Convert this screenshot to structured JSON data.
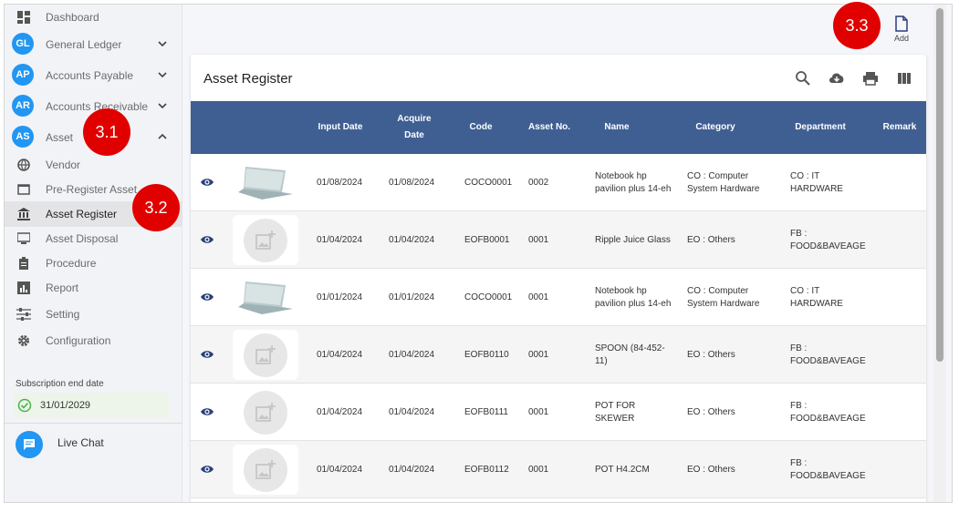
{
  "sidebar": {
    "items": [
      {
        "label": "Dashboard",
        "badge": "",
        "icon": "dashboard-icon",
        "chevron": ""
      },
      {
        "label": "General Ledger",
        "badge": "GL",
        "icon": "",
        "chevron": "down"
      },
      {
        "label": "Accounts Payable",
        "badge": "AP",
        "icon": "",
        "chevron": "down"
      },
      {
        "label": "Accounts Receivable",
        "badge": "AR",
        "icon": "",
        "chevron": "down"
      },
      {
        "label": "Asset",
        "badge": "AS",
        "icon": "",
        "chevron": "up"
      },
      {
        "label": "Vendor",
        "badge": "",
        "icon": "globe-icon",
        "chevron": ""
      },
      {
        "label": "Pre-Register Asset",
        "badge": "",
        "icon": "window-icon",
        "chevron": ""
      },
      {
        "label": "Asset Register",
        "badge": "",
        "icon": "bank-icon",
        "chevron": "",
        "active": true
      },
      {
        "label": "Asset Disposal",
        "badge": "",
        "icon": "monitor-icon",
        "chevron": ""
      },
      {
        "label": "Procedure",
        "badge": "",
        "icon": "clipboard-icon",
        "chevron": ""
      },
      {
        "label": "Report",
        "badge": "",
        "icon": "report-icon",
        "chevron": ""
      },
      {
        "label": "Setting",
        "badge": "",
        "icon": "sliders-icon",
        "chevron": ""
      },
      {
        "label": "Configuration",
        "badge": "",
        "icon": "gear-icon",
        "chevron": ""
      }
    ],
    "subscription_label": "Subscription end date",
    "subscription_date": "31/01/2029",
    "live_chat": "Live Chat"
  },
  "callouts": {
    "c1": "3.1",
    "c2": "3.2",
    "c3": "3.3"
  },
  "header": {
    "add_label": "Add"
  },
  "card": {
    "title": "Asset Register",
    "toolbar_icons": [
      "search-icon",
      "cloud-download-icon",
      "print-icon",
      "columns-icon"
    ]
  },
  "table": {
    "columns": {
      "input_date": "Input Date",
      "acquire_date": "Acquire Date",
      "code": "Code",
      "asset_no": "Asset No.",
      "name": "Name",
      "category": "Category",
      "department": "Department",
      "remark": "Remark"
    },
    "rows": [
      {
        "image": "laptop",
        "input_date": "01/08/2024",
        "acquire_date": "01/08/2024",
        "code": "COCO0001",
        "asset_no": "0002",
        "name": "Notebook hp pavilion plus 14-eh",
        "category": "CO : Computer System Hardware",
        "department": "CO : IT HARDWARE",
        "remark": ""
      },
      {
        "image": "placeholder",
        "input_date": "01/04/2024",
        "acquire_date": "01/04/2024",
        "code": "EOFB0001",
        "asset_no": "0001",
        "name": "Ripple Juice Glass",
        "category": "EO : Others",
        "department": "FB : FOOD&BAVEAGE",
        "remark": ""
      },
      {
        "image": "laptop",
        "input_date": "01/01/2024",
        "acquire_date": "01/01/2024",
        "code": "COCO0001",
        "asset_no": "0001",
        "name": "Notebook hp pavilion plus 14-eh",
        "category": "CO : Computer System Hardware",
        "department": "CO : IT HARDWARE",
        "remark": ""
      },
      {
        "image": "placeholder",
        "input_date": "01/04/2024",
        "acquire_date": "01/04/2024",
        "code": "EOFB0110",
        "asset_no": "0001",
        "name": "SPOON (84-452-11)",
        "category": "EO : Others",
        "department": "FB : FOOD&BAVEAGE",
        "remark": ""
      },
      {
        "image": "placeholder",
        "input_date": "01/04/2024",
        "acquire_date": "01/04/2024",
        "code": "EOFB0111",
        "asset_no": "0001",
        "name": "POT FOR SKEWER",
        "category": "EO : Others",
        "department": "FB : FOOD&BAVEAGE",
        "remark": ""
      },
      {
        "image": "placeholder",
        "input_date": "01/04/2024",
        "acquire_date": "01/04/2024",
        "code": "EOFB0112",
        "asset_no": "0001",
        "name": "POT H4.2CM",
        "category": "EO : Others",
        "department": "FB : FOOD&BAVEAGE",
        "remark": ""
      }
    ]
  },
  "colors": {
    "primary": "#2196f3",
    "header": "#3f5f93",
    "callout": "#e00000"
  }
}
